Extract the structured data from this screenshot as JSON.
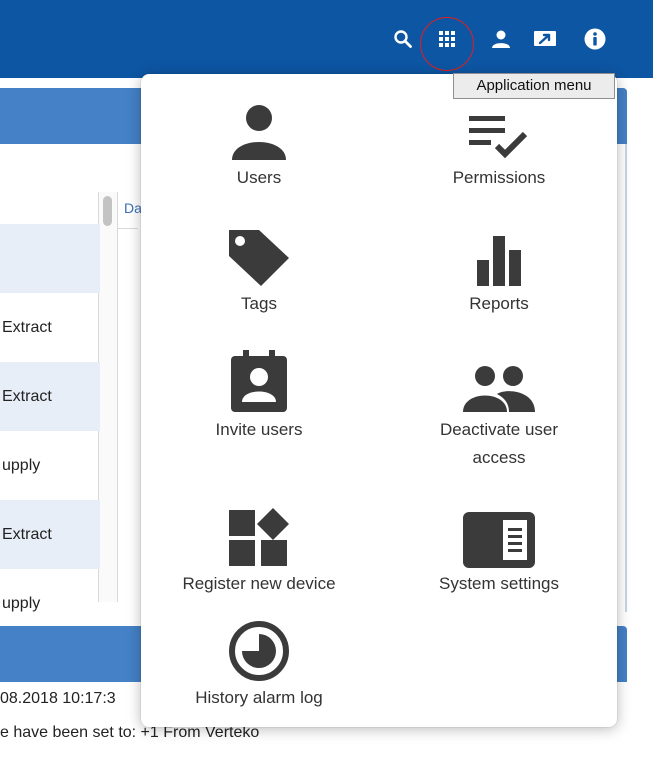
{
  "colors": {
    "topbar": "#0d56a4",
    "panel_header": "#4481c6",
    "row_shade": "#e8eef8",
    "icon_dark": "#3b3b3b",
    "highlight_ring": "#e02020"
  },
  "topbar": {
    "icons": [
      "search-icon",
      "apps-grid-icon",
      "user-icon",
      "screen-icon",
      "info-icon"
    ]
  },
  "tooltip": {
    "text": "Application menu"
  },
  "background": {
    "column_header": "Da",
    "rows": [
      {
        "text": "",
        "shaded": true
      },
      {
        "text": "Extract",
        "shaded": false
      },
      {
        "text": "Extract",
        "shaded": true
      },
      {
        "text": "upply",
        "shaded": false
      },
      {
        "text": "Extract",
        "shaded": true
      },
      {
        "text": "upply",
        "shaded": false
      }
    ],
    "log_line_1": "08.2018 10:17:3",
    "log_line_2": "e have been set to: +1 From Verteko"
  },
  "app_menu": {
    "items": [
      {
        "label": "Users",
        "icon": "user-icon"
      },
      {
        "label": "Permissions",
        "icon": "permissions-list-check-icon"
      },
      {
        "label": "Tags",
        "icon": "tag-icon"
      },
      {
        "label": "Reports",
        "icon": "bar-chart-icon"
      },
      {
        "label": "Invite users",
        "icon": "contact-badge-icon"
      },
      {
        "label": "Deactivate user access",
        "icon": "group-users-icon"
      },
      {
        "label": "Register new device",
        "icon": "widgets-icon"
      },
      {
        "label": "System settings",
        "icon": "settings-panel-icon"
      },
      {
        "label": "History alarm log",
        "icon": "clock-history-icon"
      }
    ]
  }
}
